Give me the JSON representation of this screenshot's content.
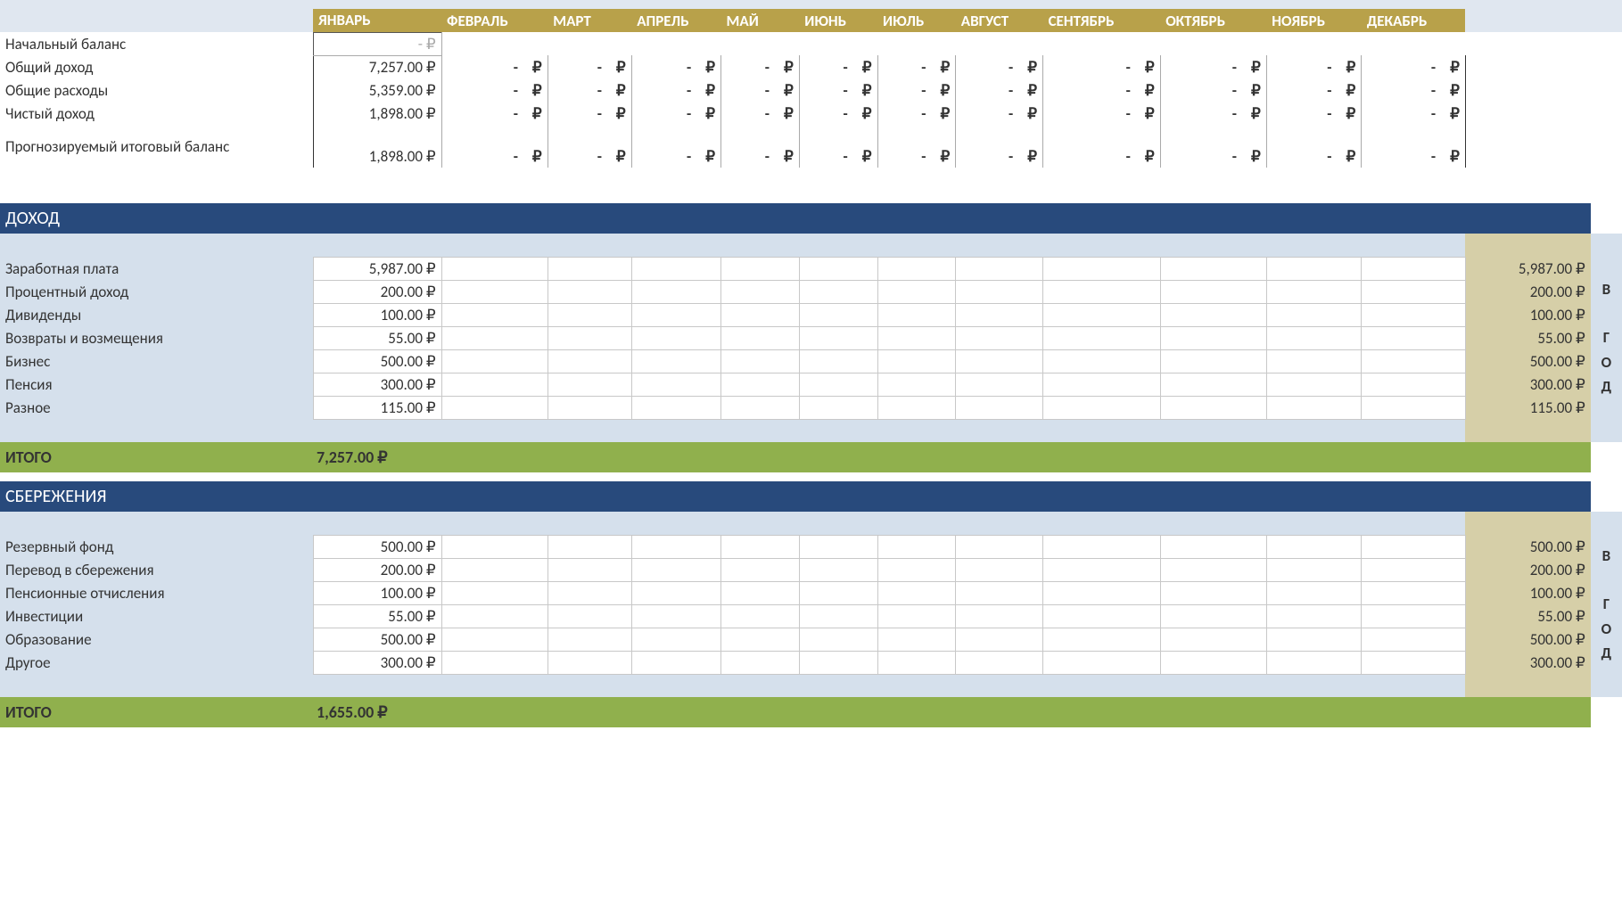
{
  "currency": "₽",
  "dash": "-",
  "months": [
    "ЯНВАРЬ",
    "ФЕВРАЛЬ",
    "МАРТ",
    "АПРЕЛЬ",
    "МАЙ",
    "ИЮНЬ",
    "ИЮЛЬ",
    "АВГУСТ",
    "СЕНТЯБРЬ",
    "ОКТЯБРЬ",
    "НОЯБРЬ",
    "ДЕКАБРЬ"
  ],
  "side_label": "В ГОД",
  "summary": {
    "rows": [
      {
        "label": "Начальный баланс",
        "jan": "-  ₽"
      },
      {
        "label": "Общий доход",
        "jan": "7,257.00 ₽"
      },
      {
        "label": "Общие расходы",
        "jan": "5,359.00 ₽"
      },
      {
        "label": "Чистый доход",
        "jan": "1,898.00 ₽"
      },
      {
        "label": "Прогнозируемый итоговый баланс",
        "jan": "1,898.00 ₽"
      }
    ]
  },
  "income": {
    "title": "ДОХОД",
    "rows": [
      {
        "label": "Заработная плата",
        "jan": "5,987.00 ₽",
        "year": "5,987.00 ₽"
      },
      {
        "label": "Процентный доход",
        "jan": "200.00 ₽",
        "year": "200.00 ₽"
      },
      {
        "label": "Дивиденды",
        "jan": "100.00 ₽",
        "year": "100.00 ₽"
      },
      {
        "label": "Возвраты и возмещения",
        "jan": "55.00 ₽",
        "year": "55.00 ₽"
      },
      {
        "label": "Бизнес",
        "jan": "500.00 ₽",
        "year": "500.00 ₽"
      },
      {
        "label": "Пенсия",
        "jan": "300.00 ₽",
        "year": "300.00 ₽"
      },
      {
        "label": "Разное",
        "jan": "115.00 ₽",
        "year": "115.00 ₽"
      }
    ],
    "total_label": "ИТОГО",
    "total": "7,257.00 ₽"
  },
  "savings": {
    "title": "СБЕРЕЖЕНИЯ",
    "rows": [
      {
        "label": "Резервный фонд",
        "jan": "500.00 ₽",
        "year": "500.00 ₽"
      },
      {
        "label": "Перевод в сбережения",
        "jan": "200.00 ₽",
        "year": "200.00 ₽"
      },
      {
        "label": "Пенсионные отисления",
        "jan": "100.00 ₽",
        "year": "100.00 ₽"
      },
      {
        "label": "Инвестиции",
        "jan": "55.00 ₽",
        "year": "55.00 ₽"
      },
      {
        "label": "Образование",
        "jan": "500.00 ₽",
        "year": "500.00 ₽"
      },
      {
        "label": "Другое",
        "jan": "300.00 ₽",
        "year": "300.00 ₽"
      }
    ],
    "total_label": "ИТОГО",
    "total": "1,655.00 ₽"
  },
  "savings_fix": {
    "2": {
      "label": "Пенсионные отчисления"
    }
  }
}
